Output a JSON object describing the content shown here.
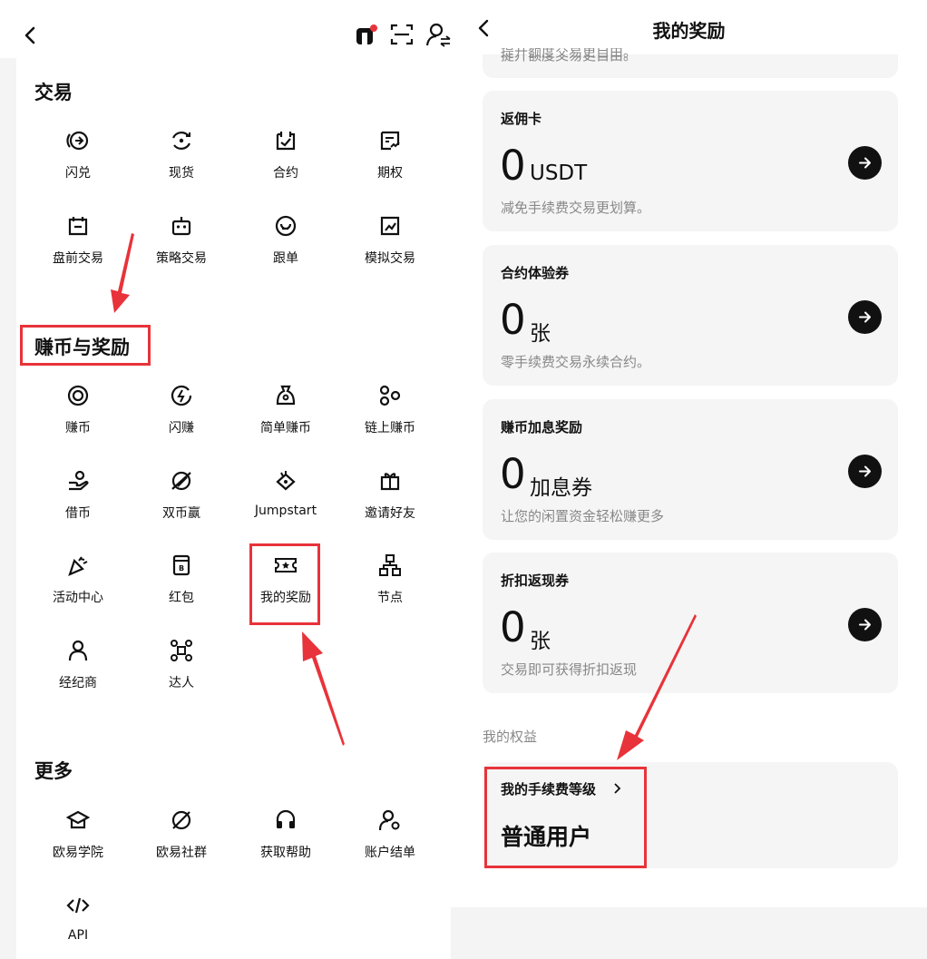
{
  "left": {
    "sections": {
      "trade": {
        "title": "交易",
        "items": [
          {
            "label": "闪兑",
            "icon": "flash-swap-icon"
          },
          {
            "label": "现货",
            "icon": "spot-icon"
          },
          {
            "label": "合约",
            "icon": "futures-icon"
          },
          {
            "label": "期权",
            "icon": "options-icon"
          },
          {
            "label": "盘前交易",
            "icon": "pre-market-icon"
          },
          {
            "label": "策略交易",
            "icon": "strategy-bot-icon"
          },
          {
            "label": "跟单",
            "icon": "copy-trading-icon"
          },
          {
            "label": "模拟交易",
            "icon": "demo-trading-icon"
          }
        ]
      },
      "earn": {
        "title": "赚币与奖励",
        "items": [
          {
            "label": "赚币",
            "icon": "earn-coin-icon"
          },
          {
            "label": "闪赚",
            "icon": "flash-earn-icon"
          },
          {
            "label": "简单赚币",
            "icon": "simple-earn-icon"
          },
          {
            "label": "链上赚币",
            "icon": "onchain-earn-icon"
          },
          {
            "label": "借币",
            "icon": "loan-icon"
          },
          {
            "label": "双币赢",
            "icon": "dual-invest-icon"
          },
          {
            "label": "Jumpstart",
            "icon": "jumpstart-icon"
          },
          {
            "label": "邀请好友",
            "icon": "gift-icon"
          },
          {
            "label": "活动中心",
            "icon": "party-popper-icon"
          },
          {
            "label": "红包",
            "icon": "red-packet-icon"
          },
          {
            "label": "我的奖励",
            "icon": "ticket-star-icon"
          },
          {
            "label": "节点",
            "icon": "node-network-icon"
          },
          {
            "label": "经纪商",
            "icon": "broker-person-icon"
          },
          {
            "label": "达人",
            "icon": "influencer-icon"
          }
        ]
      },
      "more": {
        "title": "更多",
        "items": [
          {
            "label": "欧易学院",
            "icon": "academy-icon"
          },
          {
            "label": "欧易社群",
            "icon": "community-icon"
          },
          {
            "label": "获取帮助",
            "icon": "headset-icon"
          },
          {
            "label": "账户结单",
            "icon": "account-statement-icon"
          },
          {
            "label": "API",
            "icon": "code-icon"
          }
        ]
      }
    }
  },
  "right": {
    "header": {
      "title": "我的奖励"
    },
    "partial_text": "提升额度交易更自由。",
    "cards": [
      {
        "title": "返佣卡",
        "value": "0",
        "unit": "USDT",
        "desc": "减免手续费交易更划算。"
      },
      {
        "title": "合约体验券",
        "value": "0",
        "unit": "张",
        "desc": "零手续费交易永续合约。"
      },
      {
        "title": "赚币加息奖励",
        "value": "0",
        "unit": "加息券",
        "desc": "让您的闲置资金轻松赚更多"
      },
      {
        "title": "折扣返现券",
        "value": "0",
        "unit": "张",
        "desc": "交易即可获得折扣返现"
      }
    ],
    "benefits": {
      "section_label": "我的权益",
      "fee_level_label": "我的手续费等级",
      "fee_level_value": "普通用户"
    }
  },
  "annotation_color": "#e8333a"
}
